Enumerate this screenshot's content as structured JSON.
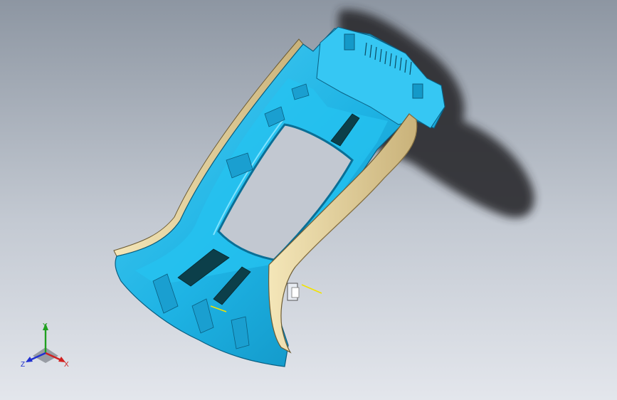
{
  "app": {
    "view": "isometric-3d-model-viewport"
  },
  "colors": {
    "background_top": "#8e97a3",
    "background_bottom": "#dfe3ea",
    "part_cyan": "#1fb6e6",
    "part_cyan_dark": "#0a6f96",
    "part_cyan_light": "#6fdcff",
    "trim_beige": "#e6d29a",
    "trim_beige_dark": "#9c8756",
    "shadow": "#2a2b2e",
    "slot_dark": "#0c3f4a",
    "axis_x": "#d02020",
    "axis_y": "#20a020",
    "axis_z": "#2030d0"
  },
  "triad": {
    "x_label": "X",
    "y_label": "Y",
    "z_label": "Z"
  }
}
